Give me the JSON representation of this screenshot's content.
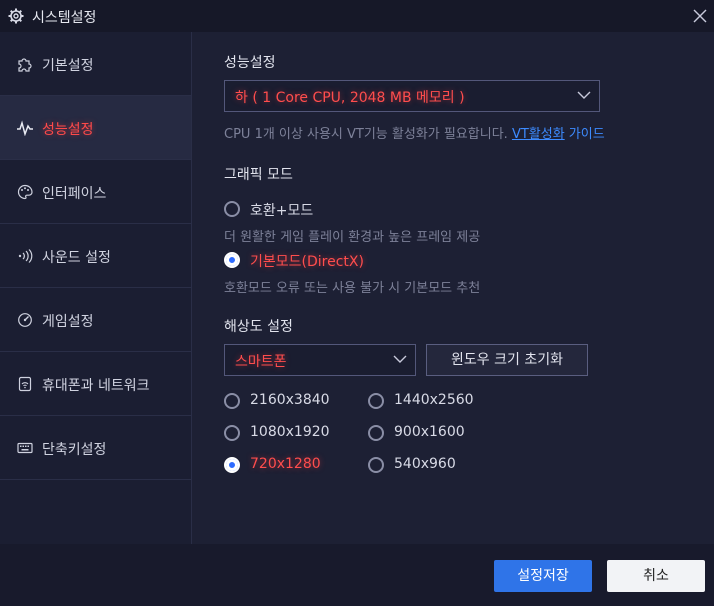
{
  "window": {
    "title": "시스템설정",
    "icons": {
      "settings": "gear-icon",
      "close": "close-icon"
    }
  },
  "sidebar": {
    "items": [
      {
        "label": "기본설정",
        "icon": "puzzle-icon",
        "active": false
      },
      {
        "label": "성능설정",
        "icon": "pulse-icon",
        "active": true
      },
      {
        "label": "인터페이스",
        "icon": "palette-icon",
        "active": false
      },
      {
        "label": "사운드 설정",
        "icon": "sound-icon",
        "active": false
      },
      {
        "label": "게임설정",
        "icon": "gauge-icon",
        "active": false
      },
      {
        "label": "휴대폰과 네트워크",
        "icon": "wifi-icon",
        "active": false
      },
      {
        "label": "단축키설정",
        "icon": "keyboard-icon",
        "active": false
      }
    ]
  },
  "performance": {
    "title": "성능설정",
    "selected": "하 ( 1 Core CPU, 2048 MB 메모리 )",
    "hint_text": "CPU 1개 이상 사용시 VT기능 활성화가 필요합니다.",
    "hint_link": "VT활성화",
    "hint_link2": "가이드"
  },
  "graphics": {
    "title": "그래픽 모드",
    "options": [
      {
        "label": "호환+모드",
        "selected": false,
        "desc": "더 원활한 게임 플레이 환경과 높은 프레임 제공"
      },
      {
        "label": "기본모드(DirectX)",
        "selected": true,
        "desc": "호환모드 오류 또는 사용 불가 시 기본모드 추천"
      }
    ]
  },
  "resolution": {
    "title": "해상도 설정",
    "device": "스마트폰",
    "reset_label": "윈도우 크기 초기화",
    "options": [
      {
        "label": "2160x3840",
        "selected": false
      },
      {
        "label": "1440x2560",
        "selected": false
      },
      {
        "label": "1080x1920",
        "selected": false
      },
      {
        "label": "900x1600",
        "selected": false
      },
      {
        "label": "720x1280",
        "selected": true
      },
      {
        "label": "540x960",
        "selected": false
      }
    ]
  },
  "footer": {
    "save_label": "설정저장",
    "cancel_label": "취소"
  },
  "colors": {
    "accent": "#2f74e8",
    "highlight_red": "#ff4d4d",
    "link": "#3d8bff"
  }
}
